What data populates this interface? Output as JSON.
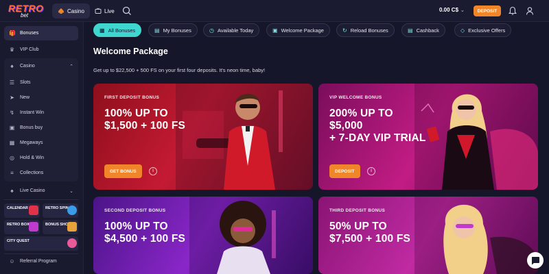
{
  "brand": {
    "logo_text": "RETRO",
    "logo_sub": "bet"
  },
  "topbar": {
    "tabs": [
      {
        "label": "Casino",
        "icon": "spade-icon",
        "active": true
      },
      {
        "label": "Live",
        "icon": "tv-icon",
        "active": false
      }
    ],
    "balance": "0.00 C$",
    "deposit_label": "DEPOSIT"
  },
  "sidebar": {
    "items": [
      {
        "label": "Bonuses",
        "icon": "gift-icon",
        "active": true
      },
      {
        "label": "VIP Club",
        "icon": "vip-icon"
      },
      {
        "label": "Casino",
        "icon": "spade-icon",
        "expanded": true
      },
      {
        "label": "Slots",
        "icon": "slots-icon"
      },
      {
        "label": "New",
        "icon": "rocket-icon"
      },
      {
        "label": "Instant Win",
        "icon": "lightning-icon"
      },
      {
        "label": "Bonus buy",
        "icon": "bag-icon"
      },
      {
        "label": "Megaways",
        "icon": "grid-icon"
      },
      {
        "label": "Hold & Win",
        "icon": "coins-icon"
      },
      {
        "label": "Collections",
        "icon": "stack-icon"
      },
      {
        "label": "Live Casino",
        "icon": "live-icon"
      },
      {
        "label": "Referral Program",
        "icon": "people-icon"
      }
    ],
    "promos": [
      "CALENDAR",
      "RETRO SPIN",
      "RETRO BOX",
      "BONUS SHOP",
      "CITY QUEST"
    ]
  },
  "filters": [
    {
      "label": "All Bonuses",
      "icon": "grid-icon",
      "active": true
    },
    {
      "label": "My Bonuses",
      "icon": "user-card-icon"
    },
    {
      "label": "Available Today",
      "icon": "clock-icon"
    },
    {
      "label": "Welcome Package",
      "icon": "gift-icon"
    },
    {
      "label": "Reload Bonuses",
      "icon": "reload-icon"
    },
    {
      "label": "Cashback",
      "icon": "cashback-icon"
    },
    {
      "label": "Exclusive Offers",
      "icon": "diamond-icon"
    }
  ],
  "section": {
    "title": "Welcome Package",
    "subtitle": "Get up to $22,500 + 500 FS on your first four deposits. It's neon time, baby!"
  },
  "cards": [
    {
      "eyebrow": "FIRST DEPOSIT BONUS",
      "headline": [
        "100% UP TO",
        "$1,500 + 100 FS"
      ],
      "cta": "GET BONUS",
      "gradient": [
        "#8e0f1c",
        "#d7203b"
      ]
    },
    {
      "eyebrow": "VIP WELCOME BONUS",
      "headline": [
        "200% UP TO",
        "$5,000",
        "+ 7-DAY VIP TRIAL"
      ],
      "cta": "DEPOSIT",
      "gradient": [
        "#7a0d5b",
        "#d0208e"
      ]
    },
    {
      "eyebrow": "SECOND DEPOSIT BONUS",
      "headline": [
        "100% UP TO",
        "$4,500 + 100 FS"
      ],
      "gradient": [
        "#4b1488",
        "#9a2fd0"
      ]
    },
    {
      "eyebrow": "THIRD DEPOSIT BONUS",
      "headline": [
        "50% UP TO",
        "$7,500 + 100 FS"
      ],
      "gradient": [
        "#8a1475",
        "#c82aa8"
      ]
    }
  ],
  "colors": {
    "accent_orange": "#f0852a",
    "accent_teal": "#3fd6d0",
    "bg": "#16162a"
  }
}
